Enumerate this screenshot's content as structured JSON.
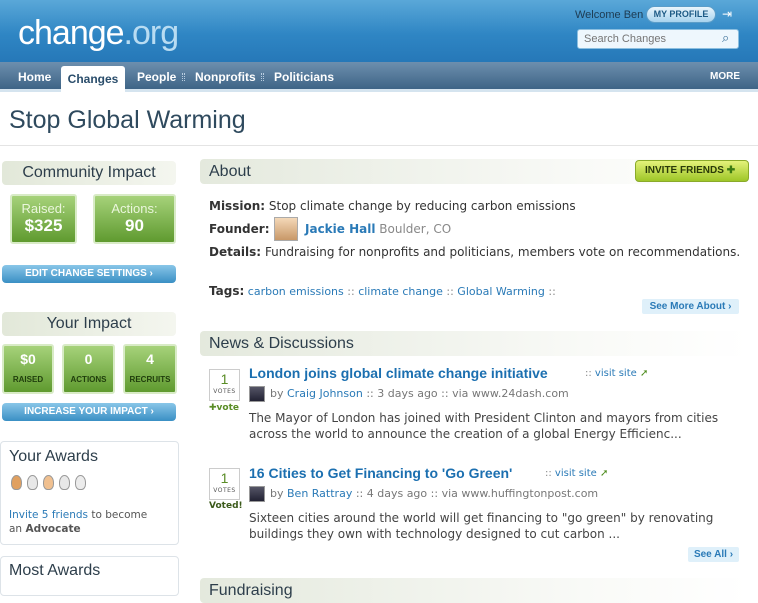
{
  "header": {
    "logo_main": "change",
    "logo_suffix": ".org",
    "welcome": "Welcome Ben",
    "profile_label": "MY PROFILE",
    "search_placeholder": "Search Changes"
  },
  "nav": {
    "items": [
      "Home",
      "Changes",
      "People",
      "Nonprofits",
      "Politicians"
    ],
    "more": "MORE"
  },
  "page_title": "Stop Global Warming",
  "community_impact": {
    "title": "Community Impact",
    "raised_label": "Raised:",
    "raised_value": "$325",
    "actions_label": "Actions:",
    "actions_value": "90",
    "settings_button": "EDIT CHANGE SETTINGS"
  },
  "your_impact": {
    "title": "Your Impact",
    "raised_value": "$0",
    "raised_label": "RAISED",
    "actions_value": "0",
    "actions_label": "ACTIONS",
    "recruits_value": "4",
    "recruits_label": "RECRUITS",
    "increase_button": "INCREASE YOUR IMPACT"
  },
  "your_awards": {
    "title": "Your Awards",
    "invite_link": "Invite 5 friends",
    "invite_text": " to become",
    "invite_text2": "an ",
    "invite_target": "Advocate"
  },
  "most_awards": {
    "title": "Most Awards"
  },
  "about": {
    "title": "About",
    "invite_button": "INVITE FRIENDS",
    "mission_label": "Mission:",
    "mission": "Stop climate change by reducing carbon emissions",
    "founder_label": "Founder:",
    "founder_name": "Jackie Hall",
    "founder_location": "Boulder, CO",
    "details_label": "Details:",
    "details": "Fundraising for nonprofits and politicians, members vote on recommendations.",
    "tags_label": "Tags:",
    "tags": [
      "carbon emissions",
      "climate change",
      "Global Warming"
    ],
    "see_more": "See More About"
  },
  "news": {
    "title": "News & Discussions",
    "see_all": "See All",
    "visit_site": "visit site",
    "votes_label": "VOTES",
    "items": [
      {
        "votes": "1",
        "vote_action": "vote",
        "title": "London joins global climate change initiative",
        "by": "by",
        "author": "Craig Johnson",
        "time": "3 days ago",
        "via": "via www.24dash.com",
        "body": "The Mayor of London has joined with President Clinton and mayors from cities across the world to announce the creation of a global Energy Efficienc..."
      },
      {
        "votes": "1",
        "vote_action": "Voted!",
        "title": "16 Cities to Get Financing to 'Go Green'",
        "by": "by",
        "author": "Ben Rattray",
        "time": "4 days ago",
        "via": "via www.huffingtonpost.com",
        "body": "Sixteen cities around the world will get financing to \"go green\" by renovating buildings they own with technology designed to cut carbon ..."
      }
    ]
  },
  "next_section": {
    "title": "Fundraising"
  },
  "colors": {
    "header_blue": "#2f86c4",
    "nav_bg": "#4f7597",
    "link": "#2a7ab7",
    "impact_green": "#6ea83a",
    "invite_button": "#b6d83a"
  }
}
